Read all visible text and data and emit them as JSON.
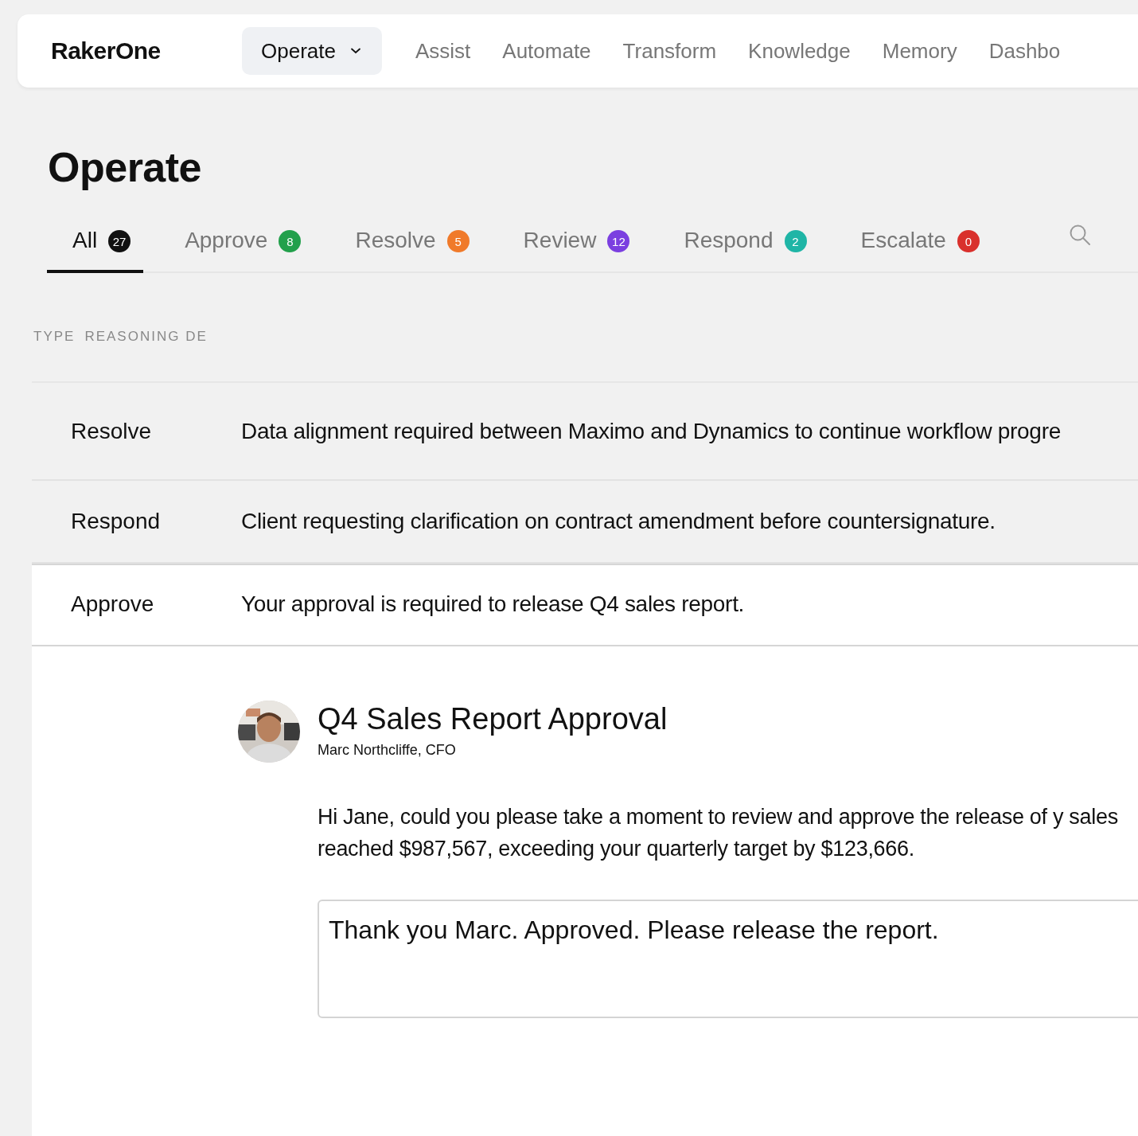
{
  "nav": {
    "logo": "RakerOne",
    "items": [
      {
        "label": "Operate",
        "selected": true,
        "kind": "dropdown"
      },
      {
        "label": "Assist",
        "selected": false,
        "kind": "link"
      },
      {
        "label": "Automate",
        "selected": false,
        "kind": "link"
      },
      {
        "label": "Transform",
        "selected": false,
        "kind": "link"
      },
      {
        "label": "Knowledge",
        "selected": false,
        "kind": "link"
      },
      {
        "label": "Memory",
        "selected": false,
        "kind": "link"
      },
      {
        "label": "Dashbo",
        "selected": false,
        "kind": "link"
      }
    ]
  },
  "page_title": "Operate",
  "tabs": [
    {
      "label": "All",
      "count": "27",
      "color": "#111111",
      "selected": true
    },
    {
      "label": "Approve",
      "count": "8",
      "color": "#22a04b",
      "selected": false
    },
    {
      "label": "Resolve",
      "count": "5",
      "color": "#f07a2a",
      "selected": false
    },
    {
      "label": "Review",
      "count": "12",
      "color": "#7b3fe0",
      "selected": false
    },
    {
      "label": "Respond",
      "count": "2",
      "color": "#1fb5a6",
      "selected": false
    },
    {
      "label": "Escalate",
      "count": "0",
      "color": "#d9302c",
      "selected": false
    }
  ],
  "table": {
    "columns": [
      "TYPE",
      "REASONING DE"
    ],
    "rows": [
      {
        "type": "Resolve",
        "description": "Data alignment required between Maximo and Dynamics to continue workflow progre",
        "selected": false
      },
      {
        "type": "Respond",
        "description": "Client requesting clarification on contract amendment before countersignature.",
        "selected": false
      },
      {
        "type": "Approve",
        "description": "Your approval is required to release Q4 sales report.",
        "selected": true
      }
    ]
  },
  "detail": {
    "title": "Q4 Sales Report Approval",
    "author": "Marc Northcliffe, CFO",
    "message": "Hi Jane, could you please take a moment to review and approve the release of y sales reached $987,567, exceeding your quarterly target by $123,666.",
    "reply": "Thank you Marc. Approved. Please release the report."
  }
}
